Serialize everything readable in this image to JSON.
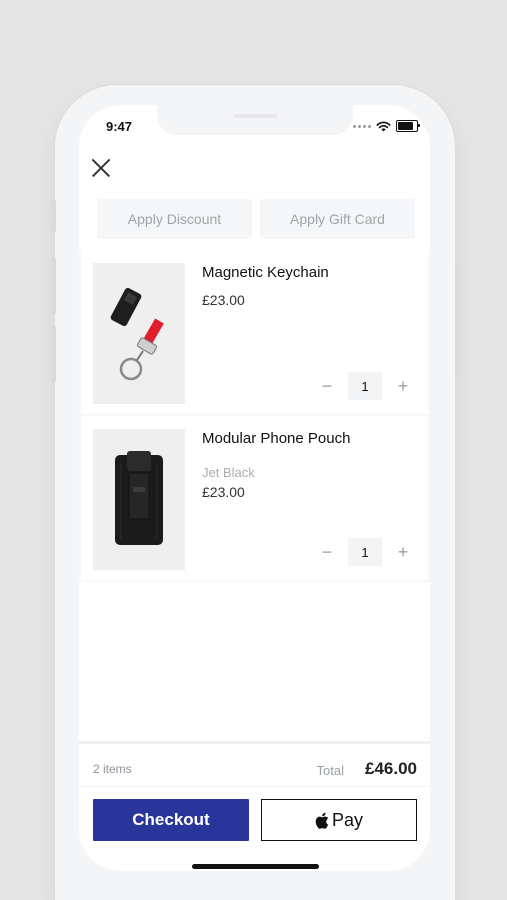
{
  "status": {
    "time": "9:47"
  },
  "promos": {
    "discount_label": "Apply Discount",
    "gift_card_label": "Apply Gift Card"
  },
  "cart": {
    "items": [
      {
        "name": "Magnetic Keychain",
        "variant": "",
        "price": "£23.00",
        "quantity": "1",
        "minus": "−",
        "plus": "+"
      },
      {
        "name": "Modular Phone Pouch",
        "variant": "Jet Black",
        "price": "£23.00",
        "quantity": "1",
        "minus": "−",
        "plus": "+"
      }
    ]
  },
  "summary": {
    "items_count": "2 items",
    "total_label": "Total",
    "total_value": "£46.00"
  },
  "actions": {
    "checkout_label": "Checkout",
    "applepay_label": "Pay"
  },
  "colors": {
    "background": "#e6e6e6",
    "checkout": "#2a359b",
    "keychain_strap": "#e11d2a"
  },
  "icons": [
    "close-icon",
    "wifi-icon",
    "battery-icon",
    "signal-icon",
    "apple-logo-icon",
    "minus-icon",
    "plus-icon"
  ]
}
